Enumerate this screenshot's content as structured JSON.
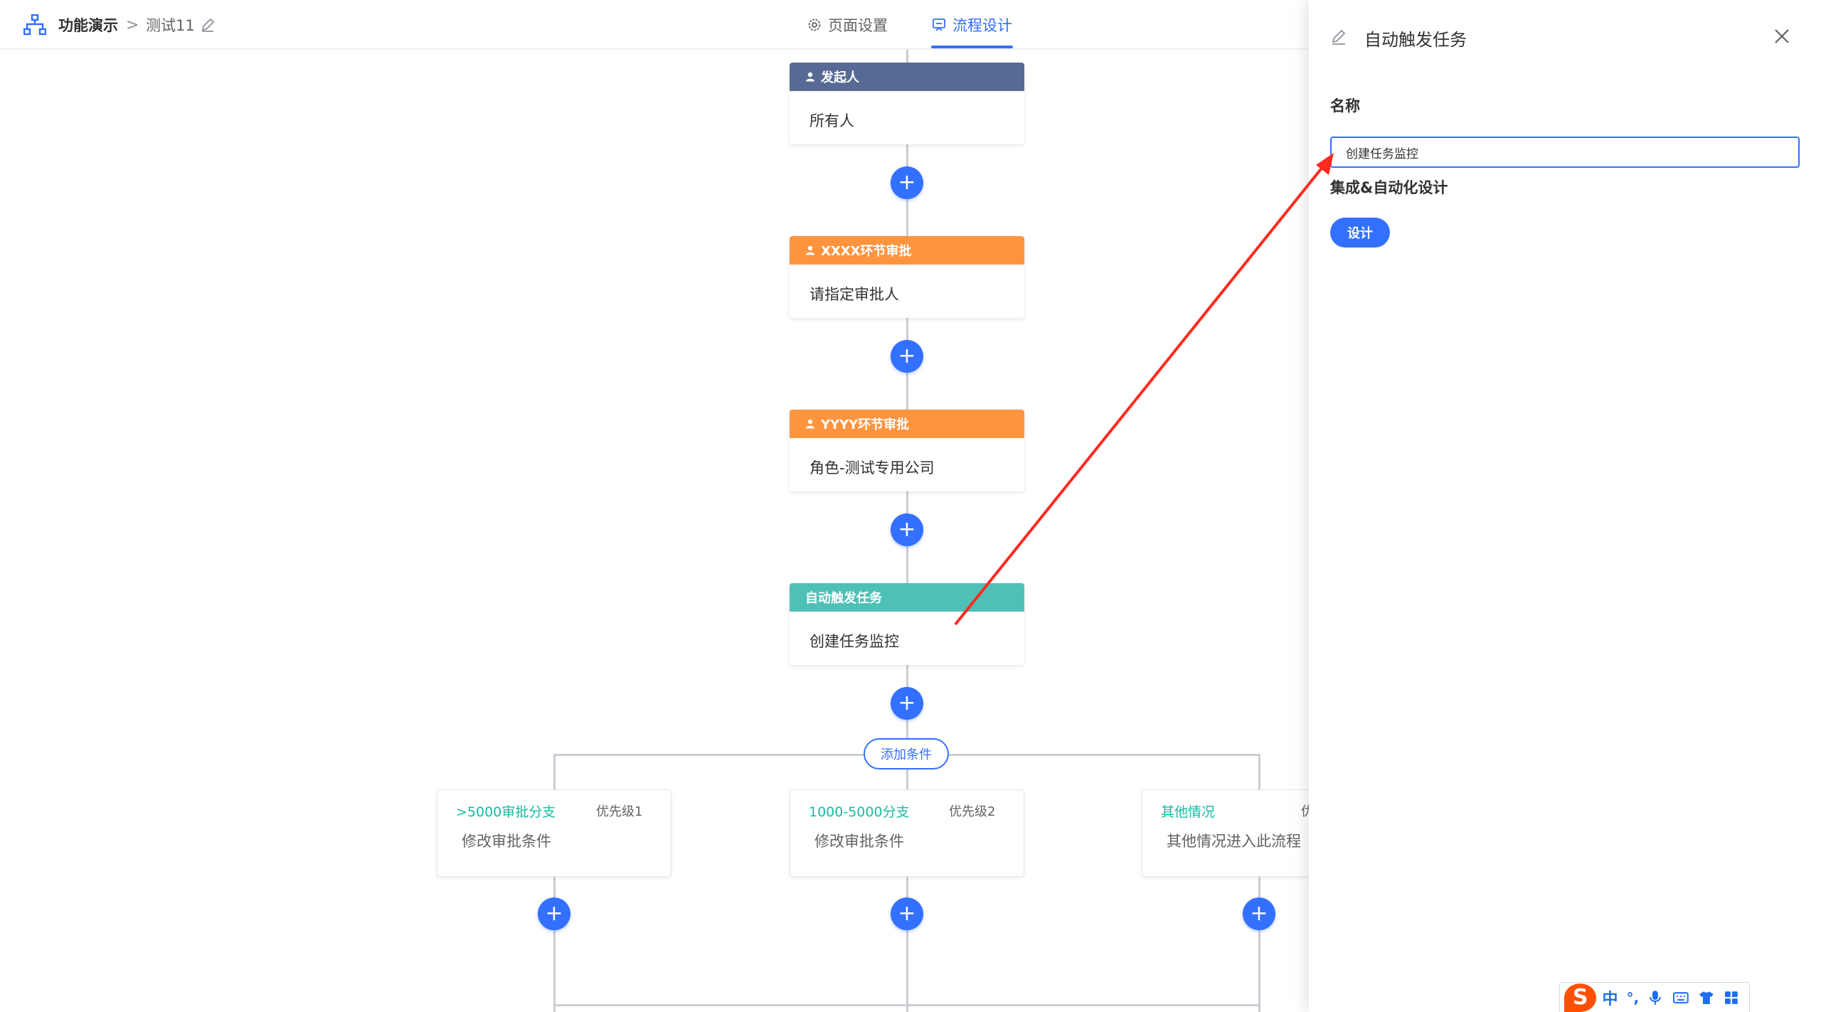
{
  "header": {
    "app_name": "功能演示",
    "separator": ">",
    "current": "测试11",
    "tabs": [
      {
        "label": "页面设置",
        "icon": "gear-icon",
        "active": false
      },
      {
        "label": "流程设计",
        "icon": "flow-icon",
        "active": true
      }
    ]
  },
  "flow": {
    "nodes": [
      {
        "kind": "start",
        "title": "发起人",
        "body": "所有人",
        "icon": "user-icon"
      },
      {
        "kind": "approve",
        "title": "XXXX环节审批",
        "body": "请指定审批人",
        "icon": "user-icon"
      },
      {
        "kind": "approve",
        "title": "YYYY环节审批",
        "body": "角色-测试专用公司",
        "icon": "user-icon"
      },
      {
        "kind": "auto",
        "title": "自动触发任务",
        "body": "创建任务监控"
      }
    ],
    "add_symbol": "+",
    "add_condition_label": "添加条件",
    "conditions": [
      {
        "title": ">5000审批分支",
        "priority": "优先级1",
        "body": "修改审批条件"
      },
      {
        "title": "1000-5000分支",
        "priority": "优先级2",
        "body": "修改审批条件"
      },
      {
        "title": "其他情况",
        "priority": "优",
        "body": "其他情况进入此流程"
      }
    ]
  },
  "drawer": {
    "title": "自动触发任务",
    "name_label": "名称",
    "name_value": "创建任务监控",
    "integration_label": "集成&自动化设计",
    "design_button": "设计"
  },
  "ime": {
    "logo": "S",
    "mode": "中",
    "punct": "°,",
    "icons": [
      "microphone-icon",
      "keyboard-icon",
      "shirt-icon",
      "apps-grid-icon"
    ]
  },
  "colors": {
    "primary": "#3370ff",
    "start_header": "#576a95",
    "approve_header": "#ff943e",
    "auto_header": "#4ec0b6",
    "condition_title": "#15bca3",
    "annotation_arrow": "#ff2a1f"
  }
}
